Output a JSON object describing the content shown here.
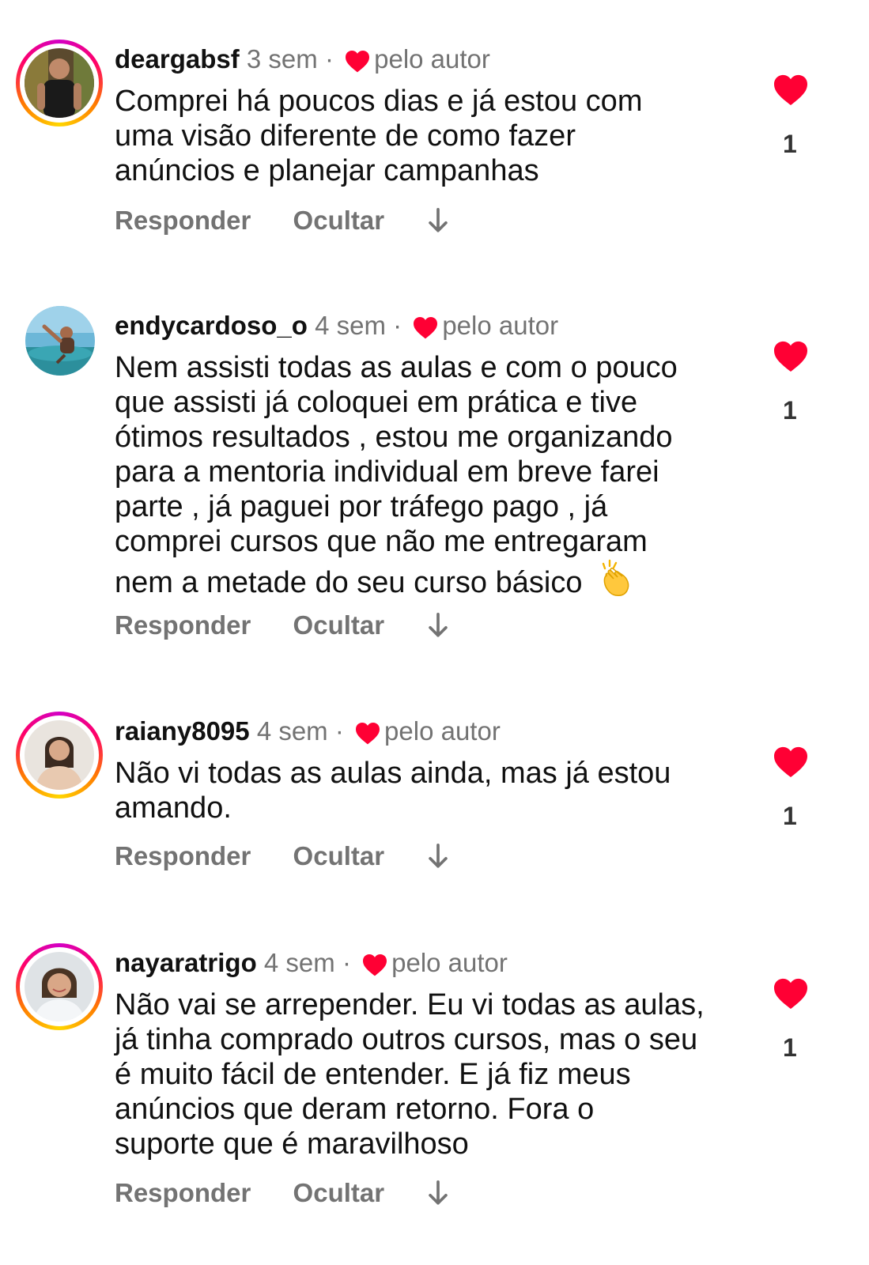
{
  "colors": {
    "heart": "#ff0034",
    "meta": "#737373",
    "text": "#111111"
  },
  "labels": {
    "reply": "Responder",
    "hide": "Ocultar",
    "author_liked": "pelo autor",
    "separator": "·"
  },
  "comments": [
    {
      "username": "deargabsf",
      "time": "3 sem",
      "lines": [
        "Comprei há poucos dias e já estou com",
        "uma visão diferente de como fazer",
        "anúncios e planejar campanhas"
      ],
      "likes": "1",
      "avatar": "story-ring"
    },
    {
      "username": "endycardoso_o",
      "time": "4 sem",
      "lines": [
        "Nem assisti todas as aulas e com o pouco",
        "que assisti já coloquei em prática e tive",
        "ótimos resultados , estou me organizando",
        "para a mentoria individual em breve farei",
        "parte , já paguei por tráfego pago , já",
        "comprei cursos que não me entregaram",
        "nem a metade  do seu curso básico"
      ],
      "emoji": "clapping-hands",
      "likes": "1",
      "avatar": "plain"
    },
    {
      "username": "raiany8095",
      "time": "4 sem",
      "lines": [
        "Não vi todas as aulas ainda, mas já estou",
        "amando."
      ],
      "likes": "1",
      "avatar": "story-ring"
    },
    {
      "username": "nayaratrigo",
      "time": "4 sem",
      "lines": [
        "Não vai se arrepender. Eu vi todas as aulas,",
        "já tinha comprado outros cursos, mas o seu",
        "é muito fácil de entender. E já fiz meus",
        "anúncios que deram retorno. Fora o",
        "suporte que é maravilhoso"
      ],
      "likes": "1",
      "avatar": "story-ring"
    }
  ]
}
